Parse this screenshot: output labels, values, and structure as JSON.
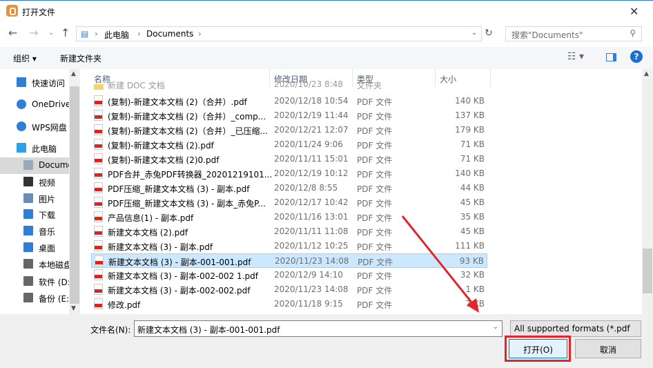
{
  "window": {
    "title": "打开文件",
    "close": "✕"
  },
  "address": {
    "segments": [
      "此电脑",
      "Documents"
    ],
    "search_placeholder": "搜索\"Documents\""
  },
  "toolbar": {
    "organize": "组织 ▾",
    "new_folder": "新建文件夹",
    "help": "?"
  },
  "sidebar": {
    "items": [
      {
        "label": "快速访问",
        "icon": "star-icon"
      },
      {
        "label": "OneDrive",
        "icon": "cloud-icon"
      },
      {
        "label": "WPS网盘",
        "icon": "cloud-icon"
      },
      {
        "label": "此电脑",
        "icon": "computer-icon"
      },
      {
        "label": "Documents",
        "icon": "document-icon"
      },
      {
        "label": "视频",
        "icon": "video-icon"
      },
      {
        "label": "图片",
        "icon": "picture-icon"
      },
      {
        "label": "下载",
        "icon": "download-icon"
      },
      {
        "label": "音乐",
        "icon": "music-icon"
      },
      {
        "label": "桌面",
        "icon": "desktop-icon"
      },
      {
        "label": "本地磁盘",
        "icon": "drive-icon"
      },
      {
        "label": "软件 (D:)",
        "icon": "drive-icon"
      },
      {
        "label": "备份 (E:)",
        "icon": "drive-icon"
      }
    ]
  },
  "columns": {
    "name": "名称",
    "date": "修改日期",
    "type": "类型",
    "size": "大小"
  },
  "partial_row": {
    "name": "新建 DOC 文档",
    "date": "2020/10/23 8:48",
    "type": "文件夹"
  },
  "files": [
    {
      "name": "(复制)-新建文本文档 (2)（合并）.pdf",
      "date": "2020/12/18 10:54",
      "type": "PDF 文件",
      "size": "140 KB"
    },
    {
      "name": "(复制)-新建文本文档 (2)（合并）_comp...",
      "date": "2020/12/19 11:44",
      "type": "PDF 文件",
      "size": "137 KB"
    },
    {
      "name": "(复制)-新建文本文档 (2)（合并）_已压缩...",
      "date": "2020/12/21 12:07",
      "type": "PDF 文件",
      "size": "179 KB"
    },
    {
      "name": "(复制)-新建文本文档 (2).pdf",
      "date": "2020/11/24 9:06",
      "type": "PDF 文件",
      "size": "71 KB"
    },
    {
      "name": "(复制)-新建文本文档 (2)0.pdf",
      "date": "2020/11/11 15:01",
      "type": "PDF 文件",
      "size": "71 KB"
    },
    {
      "name": "PDF合并_赤兔PDF转换器_20201219101...",
      "date": "2020/12/19 10:12",
      "type": "PDF 文件",
      "size": "140 KB"
    },
    {
      "name": "PDF压缩_新建文本文档 (3) - 副本.pdf",
      "date": "2020/12/8 8:55",
      "type": "PDF 文件",
      "size": "44 KB"
    },
    {
      "name": "PDF压缩_新建文本文档 (3) - 副本_赤兔P...",
      "date": "2020/12/17 10:42",
      "type": "PDF 文件",
      "size": "45 KB"
    },
    {
      "name": "产品信息(1) - 副本.pdf",
      "date": "2020/11/16 13:01",
      "type": "PDF 文件",
      "size": "35 KB"
    },
    {
      "name": "新建文本文档 (2).pdf",
      "date": "2020/11/11 11:08",
      "type": "PDF 文件",
      "size": "45 KB"
    },
    {
      "name": "新建文本文档 (3) - 副本.pdf",
      "date": "2020/11/12 10:25",
      "type": "PDF 文件",
      "size": "111 KB"
    },
    {
      "name": "新建文本文档 (3) - 副本-001-001.pdf",
      "date": "2020/11/23 14:08",
      "type": "PDF 文件",
      "size": "93 KB",
      "selected": true
    },
    {
      "name": "新建文本文档 (3) - 副本-002-002 1.pdf",
      "date": "2020/12/9 14:10",
      "type": "PDF 文件",
      "size": "32 KB"
    },
    {
      "name": "新建文本文档 (3) - 副本-002-002.pdf",
      "date": "2020/11/23 14:08",
      "type": "PDF 文件",
      "size": "1 KB"
    },
    {
      "name": "修改.pdf",
      "date": "2020/11/18 9:15",
      "type": "PDF 文件",
      "size": "7 KB"
    }
  ],
  "footer": {
    "filename_label": "文件名(N):",
    "filename_value": "新建文本文档 (3) - 副本-001-001.pdf",
    "filetype": "All supported formats (*.pdf",
    "open": "打开(O)",
    "cancel": "取消"
  },
  "colors": {
    "accent": "#0078d7",
    "selection": "#cce8ff",
    "annotation": "#e0262a"
  }
}
